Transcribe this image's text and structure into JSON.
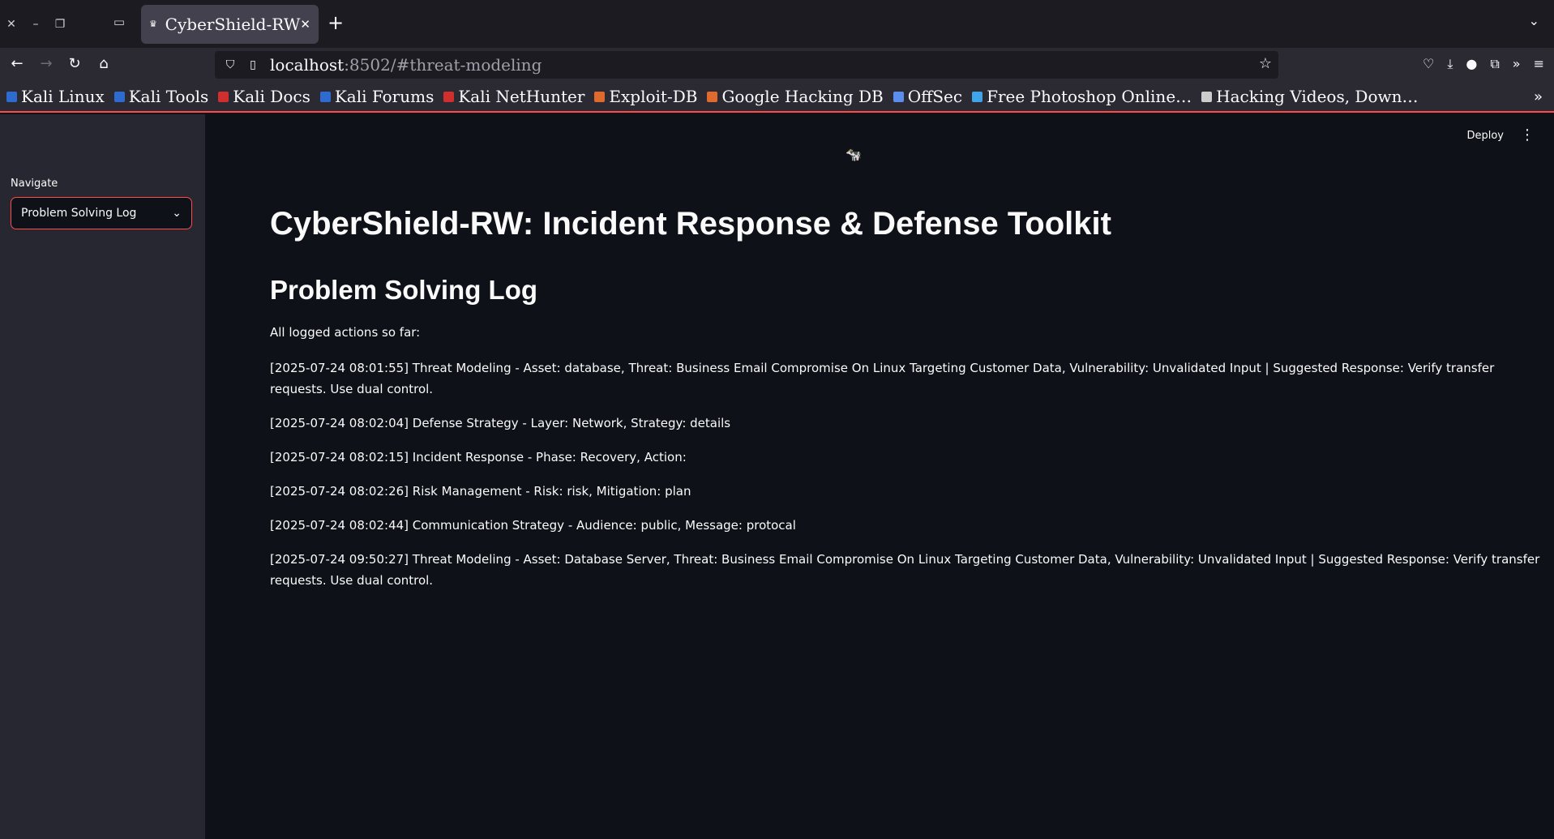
{
  "browser": {
    "tab_title": "CyberShield-RW",
    "url_host": "localhost",
    "url_rest": ":8502/#threat-modeling",
    "bookmarks": [
      {
        "label": "Kali Linux",
        "color": "#2e6bd1"
      },
      {
        "label": "Kali Tools",
        "color": "#2e6bd1"
      },
      {
        "label": "Kali Docs",
        "color": "#d12e2e"
      },
      {
        "label": "Kali Forums",
        "color": "#2e6bd1"
      },
      {
        "label": "Kali NetHunter",
        "color": "#d12e2e"
      },
      {
        "label": "Exploit-DB",
        "color": "#e0692d"
      },
      {
        "label": "Google Hacking DB",
        "color": "#e0692d"
      },
      {
        "label": "OffSec",
        "color": "#5b8def"
      },
      {
        "label": "Free Photoshop Online…",
        "color": "#3fa4e8"
      },
      {
        "label": "Hacking Videos, Down…",
        "color": "#cccccc"
      }
    ]
  },
  "sidebar": {
    "nav_label": "Navigate",
    "selected": "Problem Solving Log"
  },
  "header": {
    "deploy_label": "Deploy"
  },
  "main": {
    "title": "CyberShield-RW: Incident Response & Defense Toolkit",
    "subtitle": "Problem Solving Log",
    "intro": "All logged actions so far:",
    "entries": [
      "[2025-07-24 08:01:55] Threat Modeling - Asset: database, Threat: Business Email Compromise On Linux Targeting Customer Data, Vulnerability: Unvalidated Input | Suggested Response: Verify transfer requests. Use dual control.",
      "[2025-07-24 08:02:04] Defense Strategy - Layer: Network, Strategy: details",
      "[2025-07-24 08:02:15] Incident Response - Phase: Recovery, Action:",
      "[2025-07-24 08:02:26] Risk Management - Risk: risk, Mitigation: plan",
      "[2025-07-24 08:02:44] Communication Strategy - Audience: public, Message: protocal",
      "[2025-07-24 09:50:27] Threat Modeling - Asset: Database Server, Threat: Business Email Compromise On Linux Targeting Customer Data, Vulnerability: Unvalidated Input | Suggested Response: Verify transfer requests. Use dual control."
    ]
  },
  "colors": {
    "accent": "#ff4b4b",
    "background": "#0e1117",
    "sidebar": "#262730"
  }
}
